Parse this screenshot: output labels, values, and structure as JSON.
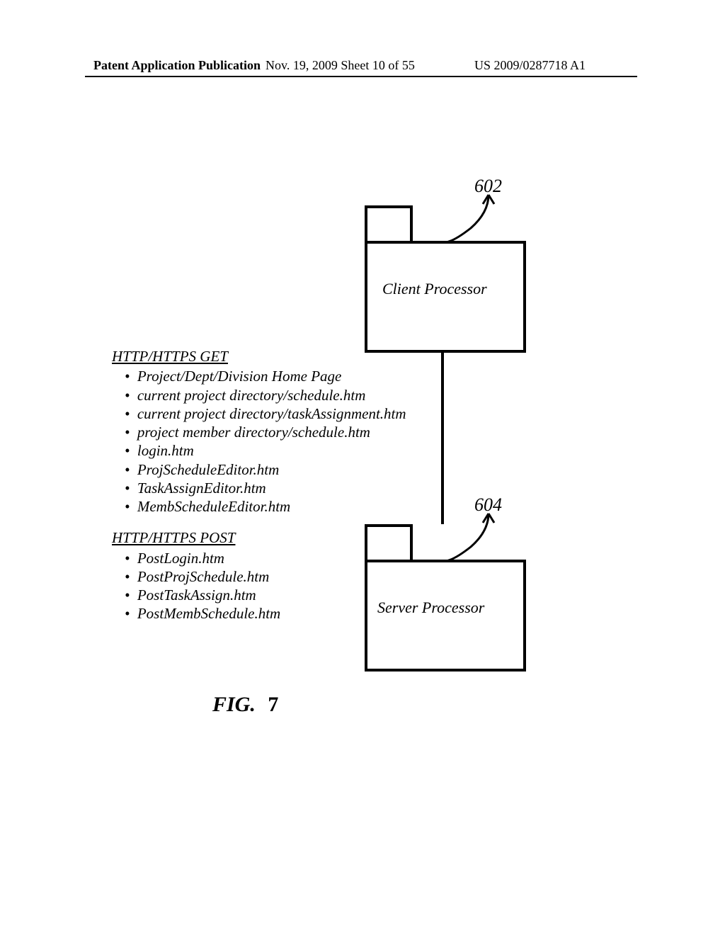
{
  "header": {
    "left": "Patent Application Publication",
    "center": "Nov. 19, 2009  Sheet 10 of 55",
    "right": "US 2009/0287718 A1"
  },
  "refs": {
    "client": "602",
    "server": "604"
  },
  "boxes": {
    "client_label": "Client Processor",
    "server_label": "Server Processor"
  },
  "get_section": {
    "title": "HTTP/HTTPS GET",
    "items": [
      "Project/Dept/Division Home Page",
      "current project directory/schedule.htm",
      "current project directory/taskAssignment.htm",
      "project member directory/schedule.htm",
      "login.htm",
      "ProjScheduleEditor.htm",
      "TaskAssignEditor.htm",
      "MembScheduleEditor.htm"
    ]
  },
  "post_section": {
    "title": "HTTP/HTTPS POST",
    "items": [
      "PostLogin.htm",
      "PostProjSchedule.htm",
      "PostTaskAssign.htm",
      "PostMembSchedule.htm"
    ]
  },
  "caption": {
    "fig": "FIG.",
    "num": "7"
  }
}
